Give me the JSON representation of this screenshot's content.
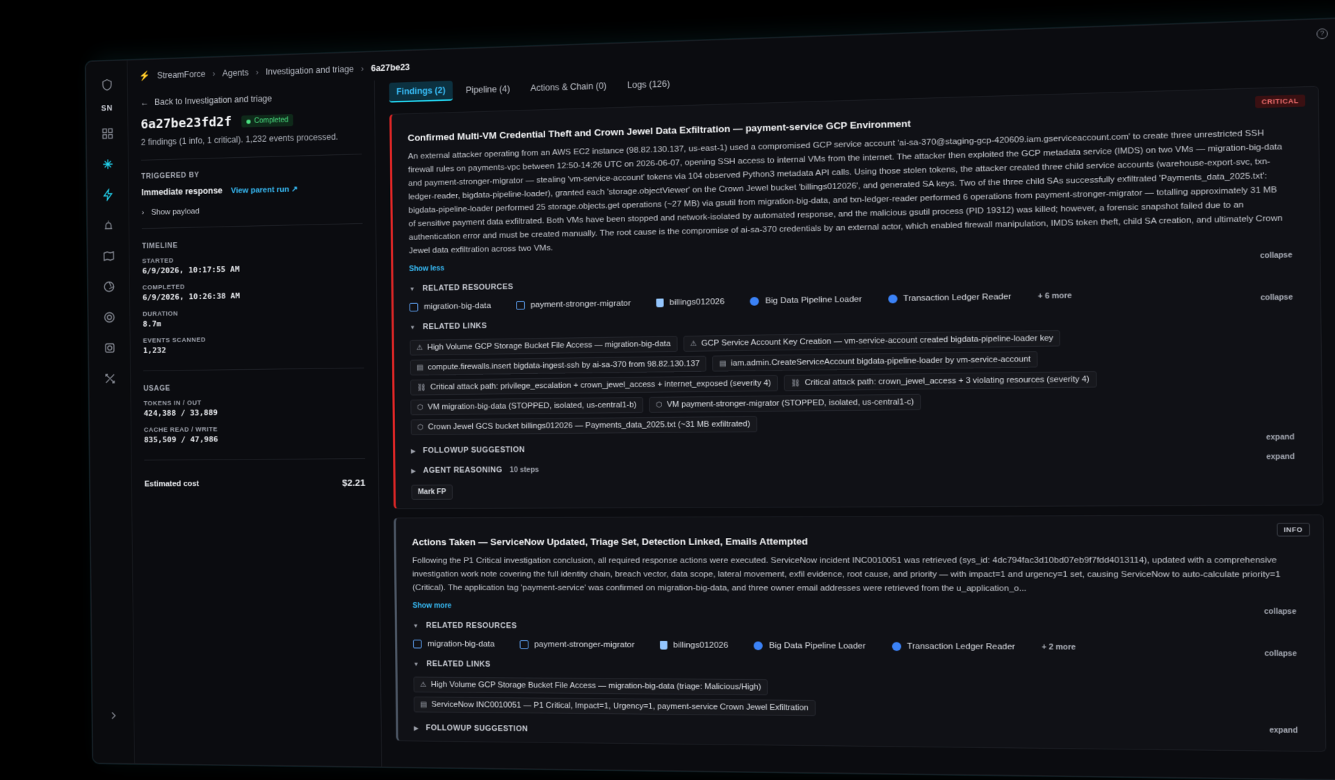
{
  "breadcrumb": [
    "StreamForce",
    "Agents",
    "Investigation and triage",
    "6a27be23"
  ],
  "rail": {
    "user_initials": "SN"
  },
  "left": {
    "back_label": "Back to Investigation and triage",
    "run_id": "6a27be23fd2f",
    "status": "Completed",
    "summary": "2 findings (1 info, 1 critical). 1,232 events processed.",
    "triggered_by_label": "TRIGGERED BY",
    "trigger_value": "Immediate response",
    "view_parent_run": "View parent run ↗",
    "show_payload": "Show payload",
    "timeline_label": "TIMELINE",
    "timeline": [
      {
        "key": "STARTED",
        "value": "6/9/2026, 10:17:55 AM"
      },
      {
        "key": "COMPLETED",
        "value": "6/9/2026, 10:26:38 AM"
      },
      {
        "key": "DURATION",
        "value": "8.7m"
      },
      {
        "key": "EVENTS SCANNED",
        "value": "1,232"
      }
    ],
    "usage_label": "USAGE",
    "usage": [
      {
        "key": "TOKENS IN / OUT",
        "value": "424,388 / 33,889"
      },
      {
        "key": "CACHE READ / WRITE",
        "value": "835,509 / 47,986"
      }
    ],
    "cost_label": "Estimated cost",
    "cost_value": "$2.21"
  },
  "tabs": [
    "Findings (2)",
    "Pipeline (4)",
    "Actions & Chain (0)",
    "Logs (126)"
  ],
  "findings": [
    {
      "severity": "CRITICAL",
      "title": "Confirmed Multi-VM Credential Theft and Crown Jewel Data Exfiltration — payment-service GCP Environment",
      "body": "An external attacker operating from an AWS EC2 instance (98.82.130.137, us-east-1) used a compromised GCP service account 'ai-sa-370@staging-gcp-420609.iam.gserviceaccount.com' to create three unrestricted SSH firewall rules on payments-vpc between 12:50-14:26 UTC on 2026-06-07, opening SSH access to internal VMs from the internet. The attacker then exploited the GCP metadata service (IMDS) on two VMs — migration-big-data and payment-stronger-migrator — stealing 'vm-service-account' tokens via 104 observed Python3 metadata API calls. Using those stolen tokens, the attacker created three child service accounts (warehouse-export-svc, txn-ledger-reader, bigdata-pipeline-loader), granted each 'storage.objectViewer' on the Crown Jewel bucket 'billings012026', and generated SA keys. Two of the three child SAs successfully exfiltrated 'Payments_data_2025.txt': bigdata-pipeline-loader performed 25 storage.objects.get operations (~27 MB) via gsutil from migration-big-data, and txn-ledger-reader performed 6 operations from payment-stronger-migrator — totalling approximately 31 MB of sensitive payment data exfiltrated. Both VMs have been stopped and network-isolated by automated response, and the malicious gsutil process (PID 19312) was killed; however, a forensic snapshot failed due to an authentication error and must be created manually. The root cause is the compromise of ai-sa-370 credentials by an external actor, which enabled firewall manipulation, IMDS token theft, child SA creation, and ultimately Crown Jewel data exfiltration across two VMs.",
      "show_toggle": "Show less",
      "collapse": "collapse",
      "expand": "expand",
      "resources_label": "RELATED RESOURCES",
      "resources": [
        "migration-big-data",
        "payment-stronger-migrator",
        "billings012026",
        "Big Data Pipeline Loader",
        "Transaction Ledger Reader"
      ],
      "resources_more": "+ 6 more",
      "links_label": "RELATED LINKS",
      "links": [
        "High Volume GCP Storage Bucket File Access — migration-big-data",
        "GCP Service Account Key Creation — vm-service-account created bigdata-pipeline-loader key",
        "compute.firewalls.insert bigdata-ingest-ssh by ai-sa-370 from 98.82.130.137",
        "iam.admin.CreateServiceAccount bigdata-pipeline-loader by vm-service-account",
        "Critical attack path: privilege_escalation + crown_jewel_access + internet_exposed (severity 4)",
        "Critical attack path: crown_jewel_access + 3 violating resources (severity 4)",
        "VM migration-big-data (STOPPED, isolated, us-central1-b)",
        "VM payment-stronger-migrator (STOPPED, isolated, us-central1-c)",
        "Crown Jewel GCS bucket billings012026 — Payments_data_2025.txt (~31 MB exfiltrated)"
      ],
      "followup_label": "FOLLOWUP SUGGESTION",
      "reasoning_label": "AGENT REASONING",
      "reasoning_steps": "10 steps",
      "mark_fp": "Mark FP"
    },
    {
      "severity": "INFO",
      "title": "Actions Taken — ServiceNow Updated, Triage Set, Detection Linked, Emails Attempted",
      "body": "Following the P1 Critical investigation conclusion, all required response actions were executed. ServiceNow incident INC0010051 was retrieved (sys_id: 4dc794fac3d10bd07eb9f7fdd4013114), updated with a comprehensive investigation work note covering the full identity chain, breach vector, data scope, lateral movement, exfil evidence, root cause, and priority — with impact=1 and urgency=1 set, causing ServiceNow to auto-calculate priority=1 (Critical). The application tag 'payment-service' was confirmed on migration-big-data, and three owner email addresses were retrieved from the u_application_o...",
      "show_toggle": "Show more",
      "collapse": "collapse",
      "expand": "expand",
      "resources_label": "RELATED RESOURCES",
      "resources": [
        "migration-big-data",
        "payment-stronger-migrator",
        "billings012026",
        "Big Data Pipeline Loader",
        "Transaction Ledger Reader"
      ],
      "resources_more": "+ 2 more",
      "links_label": "RELATED LINKS",
      "links": [
        "High Volume GCP Storage Bucket File Access — migration-big-data (triage: Malicious/High)",
        "ServiceNow INC0010051 — P1 Critical, Impact=1, Urgency=1, payment-service Crown Jewel Exfiltration"
      ],
      "followup_label": "FOLLOWUP SUGGESTION"
    }
  ]
}
